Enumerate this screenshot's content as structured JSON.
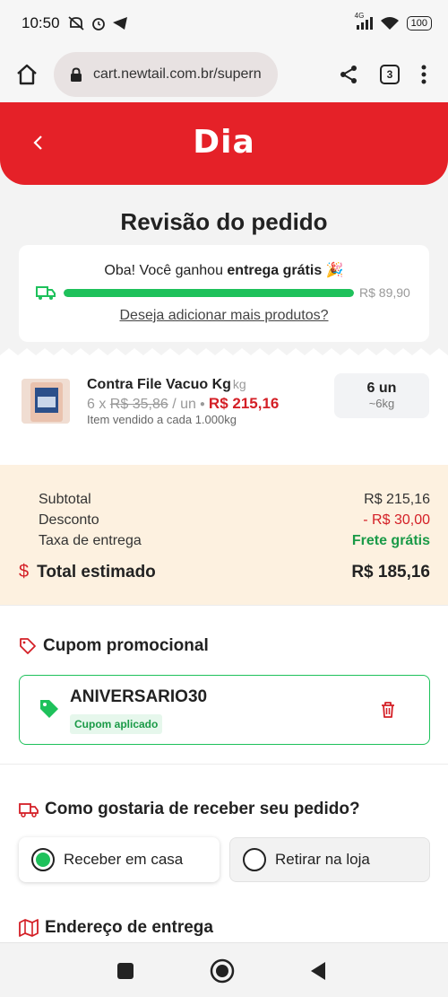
{
  "status_bar": {
    "time": "10:50",
    "signal_label": "4G",
    "battery": "100"
  },
  "browser": {
    "url": "cart.newtail.com.br/supern",
    "tab_count": "3"
  },
  "header": {
    "brand": "Dia"
  },
  "page": {
    "title": "Revisão do pedido"
  },
  "free_delivery": {
    "message_prefix": "Oba! Você ganhou ",
    "message_bold": "entrega grátis",
    "emoji": "🎉",
    "threshold": "R$ 89,90",
    "progress": 1.0,
    "add_more_link": "Deseja adicionar mais produtos?"
  },
  "product": {
    "name": "Contra File Vacuo Kg",
    "unit": "kg",
    "qty_prefix": "6 x",
    "unit_price": "R$ 35,86",
    "unit_suffix": "/ un",
    "total": "R$ 215,16",
    "sold_per": "Item vendido a cada 1.000kg",
    "quantity": "6 un",
    "approx_weight": "~6kg"
  },
  "summary": {
    "subtotal_label": "Subtotal",
    "subtotal_value": "R$ 215,16",
    "discount_label": "Desconto",
    "discount_value": "- R$ 30,00",
    "delivery_label": "Taxa de entrega",
    "delivery_value": "Frete grátis",
    "total_label": "Total estimado",
    "total_value": "R$ 185,16",
    "total_icon": "$"
  },
  "coupon": {
    "section_title": "Cupom promocional",
    "code": "ANIVERSARIO30",
    "badge": "Cupom aplicado"
  },
  "delivery_method": {
    "question": "Como gostaria de receber seu pedido?",
    "options": [
      {
        "label": "Receber em casa",
        "selected": true
      },
      {
        "label": "Retirar na loja",
        "selected": false
      }
    ]
  },
  "address": {
    "section_title": "Endereço de entrega"
  },
  "colors": {
    "brand_red": "#e52128",
    "accent_green": "#1ec15b",
    "summary_bg": "#fdf1e0"
  }
}
